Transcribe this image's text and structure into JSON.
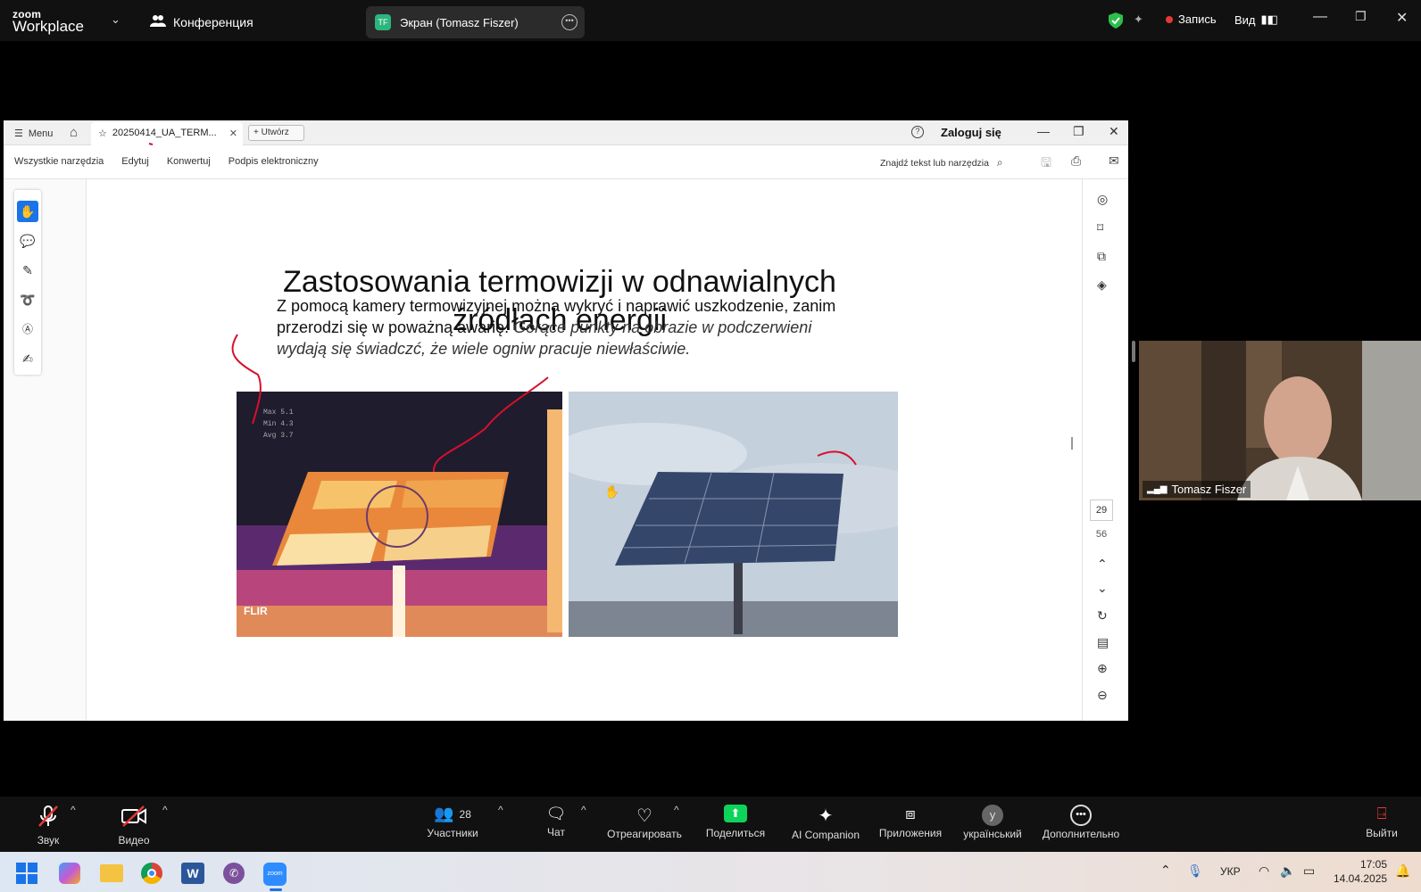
{
  "zoom": {
    "logo_small": "zoom",
    "logo_big": "Workplace",
    "meeting_label": "Конференция",
    "share_badge": "TF",
    "share_title": "Экран (Tomasz Fiszer)",
    "record_label": "Запись",
    "view_label": "Вид"
  },
  "reader": {
    "menu_label": "Menu",
    "tab_title": "20250414_UA_TERM...",
    "new_tab_label": "Utwórz",
    "login_label": "Zaloguj się",
    "tools": [
      "Wszystkie narzędzia",
      "Edytuj",
      "Konwertuj",
      "Podpis elektroniczny"
    ],
    "find_placeholder": "Znajdź tekst lub narzędzia",
    "current_page": "29",
    "total_pages": "56"
  },
  "slide": {
    "title_line1": "Zastosowania termowizji w odnawialnych",
    "title_line2": "źródłach energii",
    "body_bold": "Z pomocą kamery termowizyjnej można wykryć i naprawić uszkodzenie, zanim przerodzi się w poważną awarię.",
    "body_italic": "Gorące punkty na obrazie w podczerwieni wydają się świadczć, że wiele ogniw pracuje niewłaściwie.",
    "thermal_brand": "FLIR"
  },
  "participant": {
    "name": "Tomasz Fiszer"
  },
  "controls": {
    "audio": "Звук",
    "video": "Видео",
    "participants": "Участники",
    "participants_count": "28",
    "chat": "Чат",
    "react": "Отреагировать",
    "share": "Поделиться",
    "ai": "AI Companion",
    "apps": "Приложения",
    "language": "український",
    "language_badge": "y",
    "more": "Дополнительно",
    "leave": "Выйти"
  },
  "taskbar": {
    "lang": "УКР",
    "time": "17:05",
    "date": "14.04.2025"
  },
  "colors": {
    "accent_blue": "#1a73e8",
    "share_green": "#0ed35b",
    "record_red": "#e53935",
    "annotation_red": "#d6102b"
  }
}
